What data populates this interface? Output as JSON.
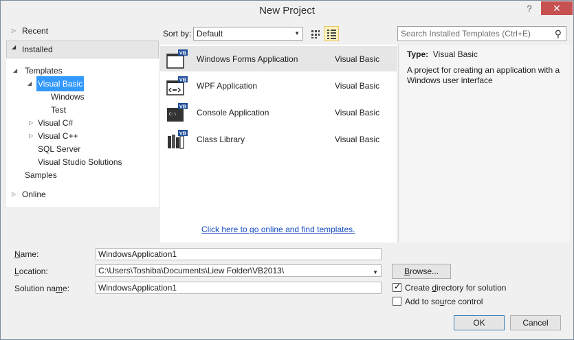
{
  "window": {
    "title": "New Project",
    "help": "?",
    "close": "✕"
  },
  "nav": {
    "recent": "Recent",
    "installed": "Installed",
    "templates": "Templates",
    "visual_basic": "Visual Basic",
    "windows": "Windows",
    "test": "Test",
    "visual_csharp": "Visual C#",
    "visual_cpp": "Visual C++",
    "sql_server": "SQL Server",
    "vs_solutions": "Visual Studio Solutions",
    "samples": "Samples",
    "online": "Online"
  },
  "toolbar": {
    "sort_by_label": "Sort by:",
    "sort_value": "Default",
    "search_placeholder": "Search Installed Templates (Ctrl+E)"
  },
  "templates": [
    {
      "name": "Windows Forms Application",
      "lang": "Visual Basic",
      "icon": "windows-forms-icon",
      "badge": "VB"
    },
    {
      "name": "WPF Application",
      "lang": "Visual Basic",
      "icon": "wpf-icon",
      "badge": "VB"
    },
    {
      "name": "Console Application",
      "lang": "Visual Basic",
      "icon": "console-icon",
      "badge": "VB",
      "console_text": "C:\\"
    },
    {
      "name": "Class Library",
      "lang": "Visual Basic",
      "icon": "class-library-icon",
      "badge": "VB"
    }
  ],
  "online_link": "Click here to go online and find templates.",
  "detail": {
    "type_label": "Type:",
    "type_value": "Visual Basic",
    "description": "A project for creating an application with a Windows user interface"
  },
  "form": {
    "name_label_pre": "",
    "name_label_u": "N",
    "name_label_post": "ame:",
    "name_value": "WindowsApplication1",
    "location_label_pre": "",
    "location_label_u": "L",
    "location_label_post": "ocation:",
    "location_value": "C:\\Users\\Toshiba\\Documents\\Liew Folder\\VB2013\\",
    "solution_label_pre": "Solution na",
    "solution_label_u": "m",
    "solution_label_post": "e:",
    "solution_value": "WindowsApplication1",
    "browse_pre": "",
    "browse_u": "B",
    "browse_post": "rowse...",
    "create_dir_pre": "Create ",
    "create_dir_u": "d",
    "create_dir_post": "irectory for solution",
    "create_dir_checked": true,
    "source_ctrl_pre": "Add to so",
    "source_ctrl_u": "u",
    "source_ctrl_post": "rce control",
    "source_ctrl_checked": false,
    "ok": "OK",
    "cancel": "Cancel"
  },
  "colors": {
    "selection": "#3399ff",
    "link": "#1a4ec0",
    "vb_badge": "#1f4e9a",
    "close": "#c75050"
  }
}
